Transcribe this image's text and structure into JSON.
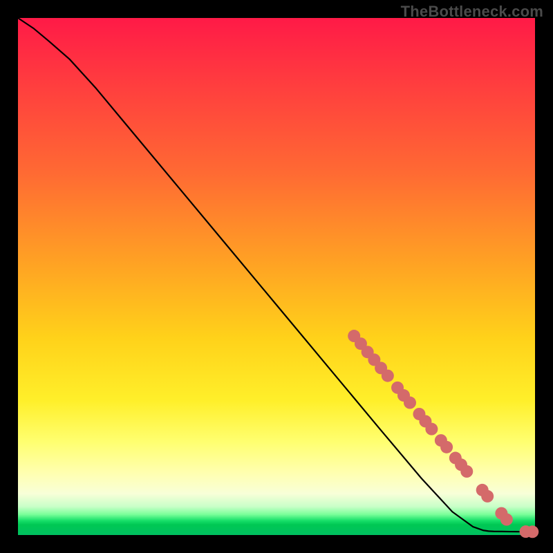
{
  "watermark": "TheBottleneck.com",
  "colors": {
    "frame": "#000000",
    "line": "#000000",
    "marker": "#d46a6a",
    "marker_stroke": "#b85555"
  },
  "chart_data": {
    "type": "line",
    "title": "",
    "xlabel": "",
    "ylabel": "",
    "xlim": [
      0,
      100
    ],
    "ylim": [
      0,
      100
    ],
    "grid": false,
    "legend": false,
    "series": [
      {
        "name": "curve",
        "x": [
          0,
          3,
          6,
          10,
          15,
          20,
          30,
          40,
          50,
          60,
          70,
          78,
          84,
          88,
          90,
          91,
          92,
          93.5,
          95,
          97,
          100
        ],
        "y": [
          100,
          98,
          95.5,
          92,
          86.5,
          80.5,
          68.5,
          56.5,
          44.5,
          32.5,
          20.5,
          11,
          4.5,
          1.6,
          0.9,
          0.75,
          0.7,
          0.68,
          0.66,
          0.64,
          0.62
        ]
      }
    ],
    "markers": [
      {
        "x": 65.0,
        "y": 38.5
      },
      {
        "x": 66.3,
        "y": 37.0
      },
      {
        "x": 67.6,
        "y": 35.4
      },
      {
        "x": 68.9,
        "y": 33.9
      },
      {
        "x": 70.2,
        "y": 32.3
      },
      {
        "x": 71.5,
        "y": 30.8
      },
      {
        "x": 73.4,
        "y": 28.5
      },
      {
        "x": 74.6,
        "y": 27.0
      },
      {
        "x": 75.8,
        "y": 25.6
      },
      {
        "x": 77.6,
        "y": 23.4
      },
      {
        "x": 78.8,
        "y": 22.0
      },
      {
        "x": 80.0,
        "y": 20.5
      },
      {
        "x": 81.8,
        "y": 18.3
      },
      {
        "x": 82.9,
        "y": 17.0
      },
      {
        "x": 84.6,
        "y": 14.9
      },
      {
        "x": 85.7,
        "y": 13.6
      },
      {
        "x": 86.8,
        "y": 12.3
      },
      {
        "x": 89.8,
        "y": 8.7
      },
      {
        "x": 90.8,
        "y": 7.5
      },
      {
        "x": 93.5,
        "y": 4.2
      },
      {
        "x": 94.5,
        "y": 3.0
      },
      {
        "x": 98.2,
        "y": 0.66
      },
      {
        "x": 99.5,
        "y": 0.63
      }
    ]
  }
}
